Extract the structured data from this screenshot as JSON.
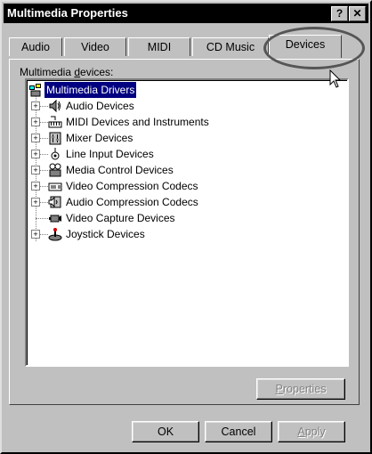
{
  "window": {
    "title": "Multimedia Properties",
    "help_button": "?",
    "close_button": "✕"
  },
  "tabs": [
    {
      "label": "Audio",
      "selected": false
    },
    {
      "label": "Video",
      "selected": false
    },
    {
      "label": "MIDI",
      "selected": false
    },
    {
      "label": "CD Music",
      "selected": false
    },
    {
      "label": "Devices",
      "selected": true
    }
  ],
  "panel": {
    "label_prefix": "Multimedia ",
    "label_accel": "d",
    "label_suffix": "evices:"
  },
  "tree": {
    "root": {
      "label": "Multimedia Drivers",
      "icon": "multimedia-drivers-icon"
    },
    "items": [
      {
        "label": "Audio Devices",
        "icon": "speaker-icon",
        "expander": "+"
      },
      {
        "label": "MIDI Devices and Instruments",
        "icon": "midi-keyboard-icon",
        "expander": "+"
      },
      {
        "label": "Mixer Devices",
        "icon": "mixer-icon",
        "expander": "+"
      },
      {
        "label": "Line Input Devices",
        "icon": "line-input-icon",
        "expander": "+"
      },
      {
        "label": "Media Control Devices",
        "icon": "media-control-icon",
        "expander": "+"
      },
      {
        "label": "Video Compression Codecs",
        "icon": "video-codec-icon",
        "expander": "+"
      },
      {
        "label": "Audio Compression Codecs",
        "icon": "audio-codec-icon",
        "expander": "+"
      },
      {
        "label": "Video Capture Devices",
        "icon": "video-capture-icon",
        "expander": ""
      },
      {
        "label": "Joystick Devices",
        "icon": "joystick-icon",
        "expander": "+"
      }
    ]
  },
  "buttons": {
    "properties_accel": "P",
    "properties_rest": "roperties",
    "ok": "OK",
    "cancel": "Cancel",
    "apply_accel": "A",
    "apply_rest": "pply"
  }
}
